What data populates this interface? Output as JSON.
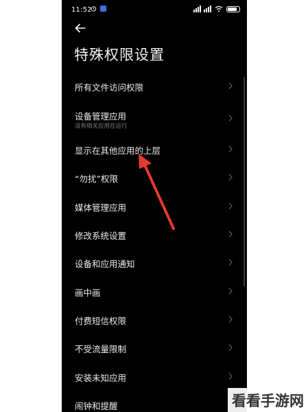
{
  "status_bar": {
    "time": "11:52",
    "icons": [
      "alarm-icon",
      "app-notification-icon",
      "signal-icon",
      "signal-icon",
      "wifi-icon",
      "battery-icon"
    ],
    "battery_level": 0.8
  },
  "header": {
    "back_icon": "back-arrow-icon",
    "title": "特殊权限设置"
  },
  "list": {
    "items": [
      {
        "label": "所有文件访问权限"
      },
      {
        "label": "设备管理应用",
        "sublabel": "没有相关应用在运行"
      },
      {
        "label": "显示在其他应用的上层"
      },
      {
        "label": "“勿扰”权限"
      },
      {
        "label": "媒体管理应用"
      },
      {
        "label": "修改系统设置"
      },
      {
        "label": "设备和应用通知"
      },
      {
        "label": "画中画"
      },
      {
        "label": "付费短信权限"
      },
      {
        "label": "不受流量限制"
      },
      {
        "label": "安装未知应用"
      },
      {
        "label": "闹钟和提醒"
      }
    ]
  },
  "annotation": {
    "color": "#e53a2d"
  },
  "watermark": {
    "text": "看看手游网"
  },
  "colors": {
    "background": "#000000",
    "text": "#ececec",
    "subtext": "#7a7a7a",
    "page": "#ffffff"
  }
}
